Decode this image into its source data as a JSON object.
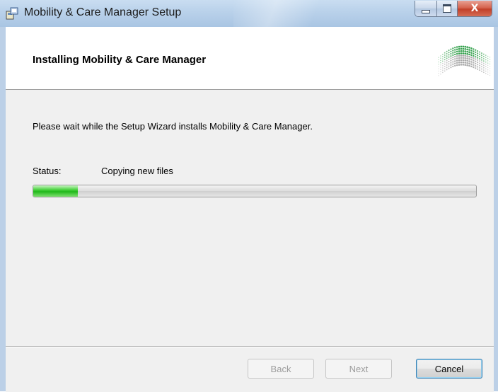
{
  "window": {
    "title": "Mobility & Care Manager Setup",
    "close_glyph": "X"
  },
  "banner": {
    "title": "Installing Mobility & Care Manager"
  },
  "main": {
    "description": "Please wait while the Setup Wizard installs Mobility & Care Manager.",
    "status_label": "Status:",
    "status_value": "Copying new files",
    "progress_fraction": 0.1
  },
  "buttons": {
    "back": "Back",
    "next": "Next",
    "cancel": "Cancel"
  },
  "colors": {
    "progress_green": "#20b81a",
    "dialog_bg": "#f0f0f0",
    "titlebar": "#b9d1ea"
  }
}
